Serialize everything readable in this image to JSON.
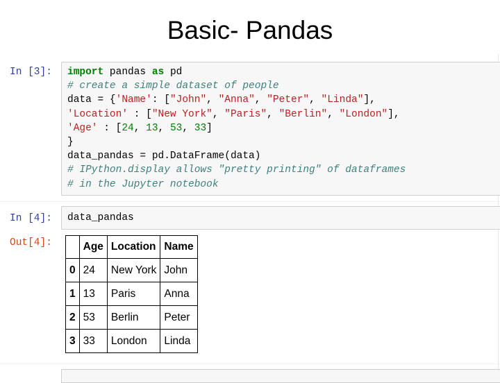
{
  "slide": {
    "title": "Basic- Pandas"
  },
  "cells": [
    {
      "prompt": "In [3]:",
      "code_lines": [
        [
          {
            "t": "import",
            "k": "kw"
          },
          {
            "t": " pandas ",
            "k": "p"
          },
          {
            "t": "as",
            "k": "kw"
          },
          {
            "t": " pd",
            "k": "p"
          }
        ],
        [
          {
            "t": "# create a simple dataset of people",
            "k": "cm"
          }
        ],
        [
          {
            "t": "data = {",
            "k": "p"
          },
          {
            "t": "'Name'",
            "k": "str"
          },
          {
            "t": ": [",
            "k": "p"
          },
          {
            "t": "\"John\"",
            "k": "str"
          },
          {
            "t": ", ",
            "k": "p"
          },
          {
            "t": "\"Anna\"",
            "k": "str"
          },
          {
            "t": ", ",
            "k": "p"
          },
          {
            "t": "\"Peter\"",
            "k": "str"
          },
          {
            "t": ", ",
            "k": "p"
          },
          {
            "t": "\"Linda\"",
            "k": "str"
          },
          {
            "t": "],",
            "k": "p"
          }
        ],
        [
          {
            "t": "'Location'",
            "k": "str"
          },
          {
            "t": " : [",
            "k": "p"
          },
          {
            "t": "\"New York\"",
            "k": "str"
          },
          {
            "t": ", ",
            "k": "p"
          },
          {
            "t": "\"Paris\"",
            "k": "str"
          },
          {
            "t": ", ",
            "k": "p"
          },
          {
            "t": "\"Berlin\"",
            "k": "str"
          },
          {
            "t": ", ",
            "k": "p"
          },
          {
            "t": "\"London\"",
            "k": "str"
          },
          {
            "t": "],",
            "k": "p"
          }
        ],
        [
          {
            "t": "'Age'",
            "k": "str"
          },
          {
            "t": " : [",
            "k": "p"
          },
          {
            "t": "24",
            "k": "num"
          },
          {
            "t": ", ",
            "k": "p"
          },
          {
            "t": "13",
            "k": "num"
          },
          {
            "t": ", ",
            "k": "p"
          },
          {
            "t": "53",
            "k": "num"
          },
          {
            "t": ", ",
            "k": "p"
          },
          {
            "t": "33",
            "k": "num"
          },
          {
            "t": "]",
            "k": "p"
          }
        ],
        [
          {
            "t": "}",
            "k": "p"
          }
        ],
        [
          {
            "t": "data_pandas = pd.DataFrame(data)",
            "k": "p"
          }
        ],
        [
          {
            "t": "# IPython.display allows \"pretty printing\" of dataframes",
            "k": "cm"
          }
        ],
        [
          {
            "t": "# in the Jupyter notebook",
            "k": "cm"
          }
        ]
      ]
    },
    {
      "prompt": "In [4]:",
      "code_lines": [
        [
          {
            "t": "data_pandas",
            "k": "p"
          }
        ]
      ]
    }
  ],
  "output": {
    "prompt": "Out[4]:",
    "table": {
      "columns": [
        "Age",
        "Location",
        "Name"
      ],
      "rows": [
        {
          "index": "0",
          "cells": [
            "24",
            "New York",
            "John"
          ]
        },
        {
          "index": "1",
          "cells": [
            "13",
            "Paris",
            "Anna"
          ]
        },
        {
          "index": "2",
          "cells": [
            "53",
            "Berlin",
            "Peter"
          ]
        },
        {
          "index": "3",
          "cells": [
            "33",
            "London",
            "Linda"
          ]
        }
      ]
    }
  },
  "colors": {
    "in_prompt": "#303f9f",
    "out_prompt": "#d84315",
    "keyword": "#008000",
    "string": "#ba2121",
    "number": "#008000",
    "comment": "#408080",
    "cell_background": "#f7f7f7",
    "cell_border": "#cfcfcf"
  }
}
